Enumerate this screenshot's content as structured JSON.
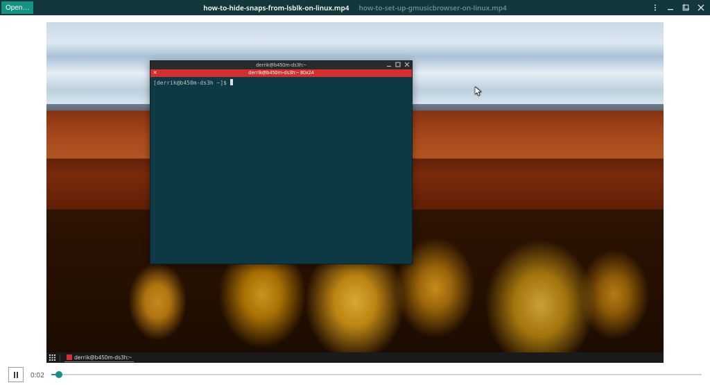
{
  "header": {
    "open_label": "Open…",
    "tabs": [
      {
        "label": "how-to-hide-snaps-from-lsblk-on-linux.mp4",
        "active": true
      },
      {
        "label": "how-to-set-up-gmusicbrowser-on-linux.mp4",
        "active": false
      }
    ]
  },
  "video": {
    "taskbar": {
      "app_title": "derrik@b450m-ds3h:~"
    },
    "terminal": {
      "title": "derrik@b450m-ds3h:~",
      "tab_label": "derrik@b450m-ds3h:~ 80x24",
      "prompt": "[derrik@b450m-ds3h ~]$ "
    }
  },
  "player": {
    "time_current": "0:02",
    "progress_pct": 1.2
  }
}
